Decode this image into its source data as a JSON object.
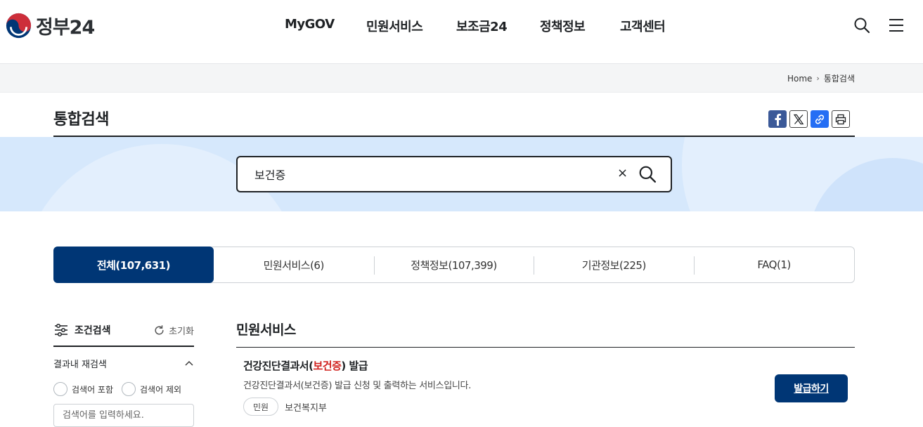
{
  "header": {
    "logo_text": "정부24",
    "nav": [
      "MyGOV",
      "민원서비스",
      "보조금24",
      "정책정보",
      "고객센터"
    ],
    "search_icon": "search-icon",
    "menu_icon": "hamburger-menu-icon"
  },
  "breadcrumb": {
    "home": "Home",
    "current": "통합검색"
  },
  "page": {
    "title": "통합검색"
  },
  "share": {
    "icons": [
      "facebook-icon",
      "x-icon",
      "link-icon",
      "print-icon"
    ]
  },
  "search": {
    "value": "보건증",
    "clear_glyph": "×"
  },
  "tabs": [
    {
      "label": "전체(107,631)",
      "active": true
    },
    {
      "label": "민원서비스(6)",
      "active": false
    },
    {
      "label": "정책정보(107,399)",
      "active": false
    },
    {
      "label": "기관정보(225)",
      "active": false
    },
    {
      "label": "FAQ(1)",
      "active": false
    }
  ],
  "filter": {
    "title": "조건검색",
    "reset": "초기화",
    "refine_title": "결과내 재검색",
    "include_label": "검색어 포함",
    "exclude_label": "검색어 제외",
    "input_placeholder": "검색어를 입력하세요."
  },
  "results": {
    "section_title": "민원서비스",
    "items": [
      {
        "title_prefix": "건강진단결과서(",
        "title_highlight": "보건증",
        "title_suffix": ") 발급",
        "description": "건강진단결과서(보건증) 발급 신청 및 출력하는 서비스입니다.",
        "tag": "민원",
        "org": "보건복지부",
        "action": "발급하기"
      }
    ]
  },
  "colors": {
    "primary": "#003675",
    "highlight": "#d1221f",
    "band": "#d6e8fc"
  }
}
